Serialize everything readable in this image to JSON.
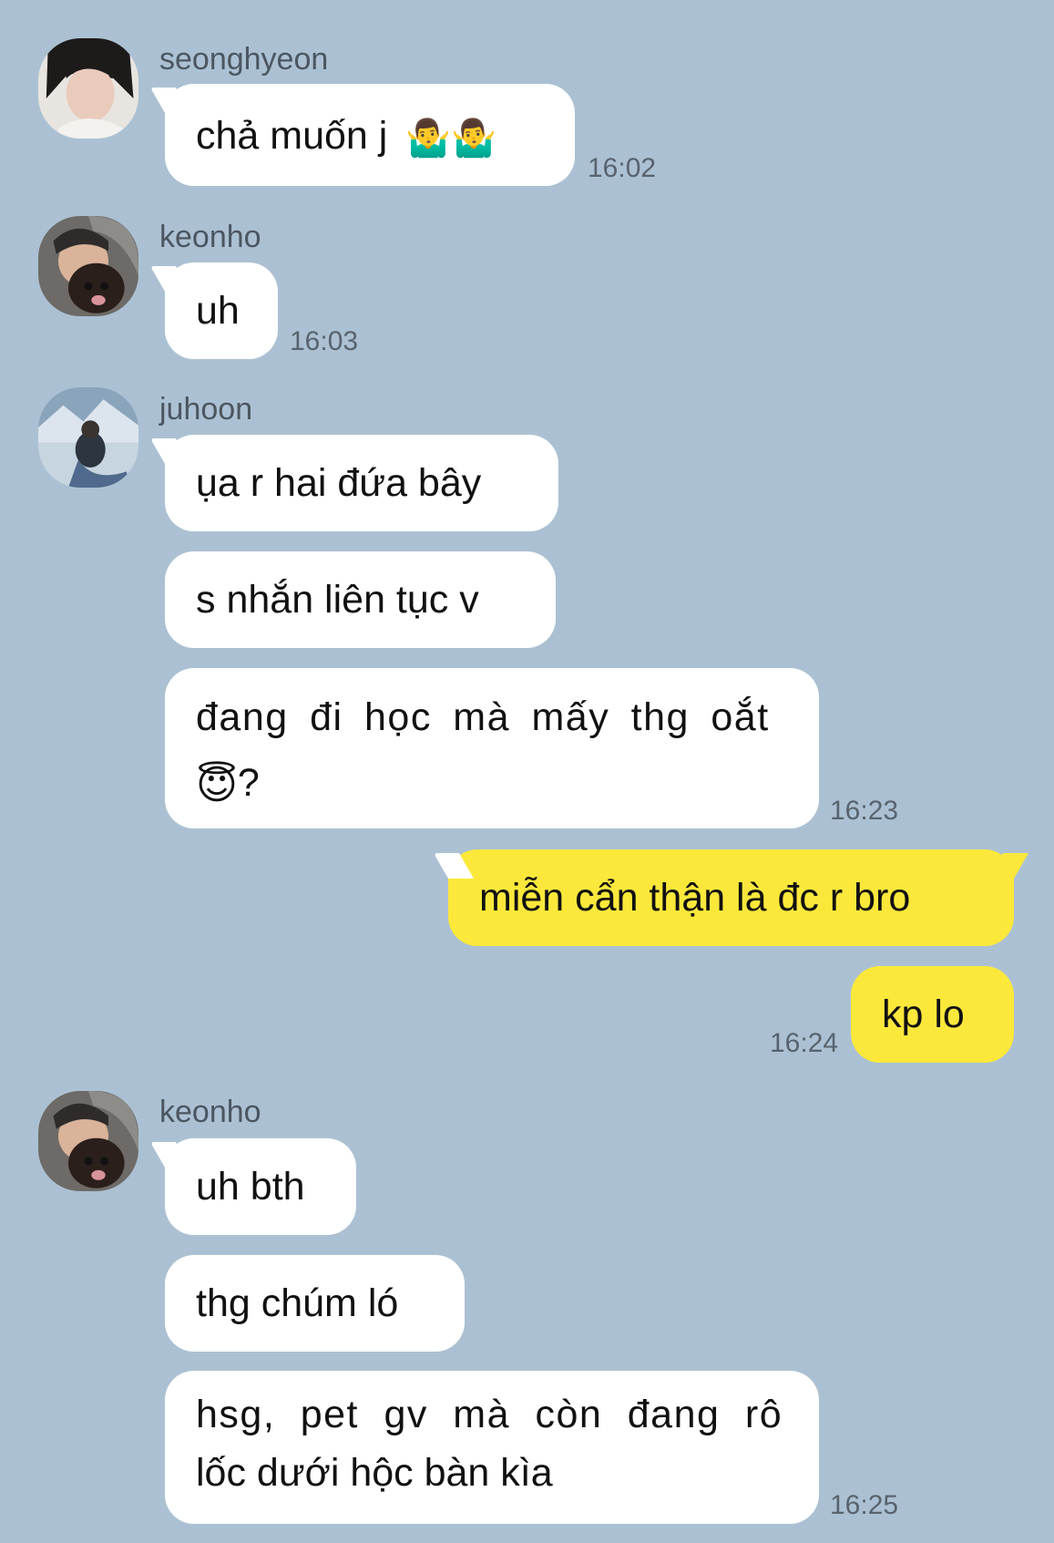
{
  "messages": [
    {
      "sender": "seonghyeon",
      "text": "chả muốn j",
      "emoji": "🤷‍♂️🤷‍♂️",
      "time": "16:02"
    },
    {
      "sender": "keonho",
      "text": "uh",
      "time": "16:03"
    },
    {
      "sender": "juhoon",
      "text": "ụa r hai đứa bây"
    },
    {
      "sender": "juhoon",
      "text": "s nhắn liên tục v"
    },
    {
      "sender": "juhoon",
      "line1": "đang đi học mà mấy thg oắt",
      "line2_emoji": "😇",
      "line2_text": "?",
      "time": "16:23"
    },
    {
      "sender": "me",
      "text": "miễn cẩn thận là đc r bro"
    },
    {
      "sender": "me",
      "text": "kp lo",
      "time": "16:24"
    },
    {
      "sender": "keonho",
      "text": "uh bth"
    },
    {
      "sender": "keonho",
      "text": "thg chúm ló"
    },
    {
      "sender": "keonho",
      "line1": "hsg, pet gv mà còn đang rô",
      "line2": "lốc dưới hộc bàn kìa",
      "time": "16:25"
    }
  ],
  "colors": {
    "background": "#abc1d3",
    "incoming_bubble": "#ffffff",
    "outgoing_bubble": "#fce83b"
  }
}
